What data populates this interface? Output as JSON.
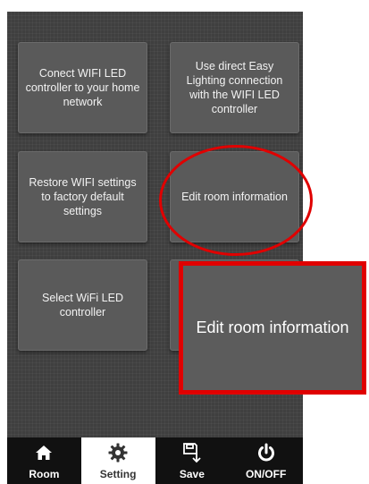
{
  "tiles": {
    "connect": "Conect WIFI LED controller to your home network",
    "direct": "Use direct Easy Lighting connection with the WIFI LED controller",
    "restore": "Restore WIFI settings to factory default settings",
    "edit_room": "Edit room information",
    "select": "Select WiFi LED controller"
  },
  "zoom": {
    "label": "Edit room information"
  },
  "tabs": [
    {
      "label": "Room",
      "icon": "home-icon"
    },
    {
      "label": "Setting",
      "icon": "gear-icon"
    },
    {
      "label": "Save",
      "icon": "save-icon"
    },
    {
      "label": "ON/OFF",
      "icon": "power-icon"
    }
  ],
  "colors": {
    "annotation": "#e00000",
    "tile": "#5a5a5a",
    "background": "#3f3f3f"
  }
}
